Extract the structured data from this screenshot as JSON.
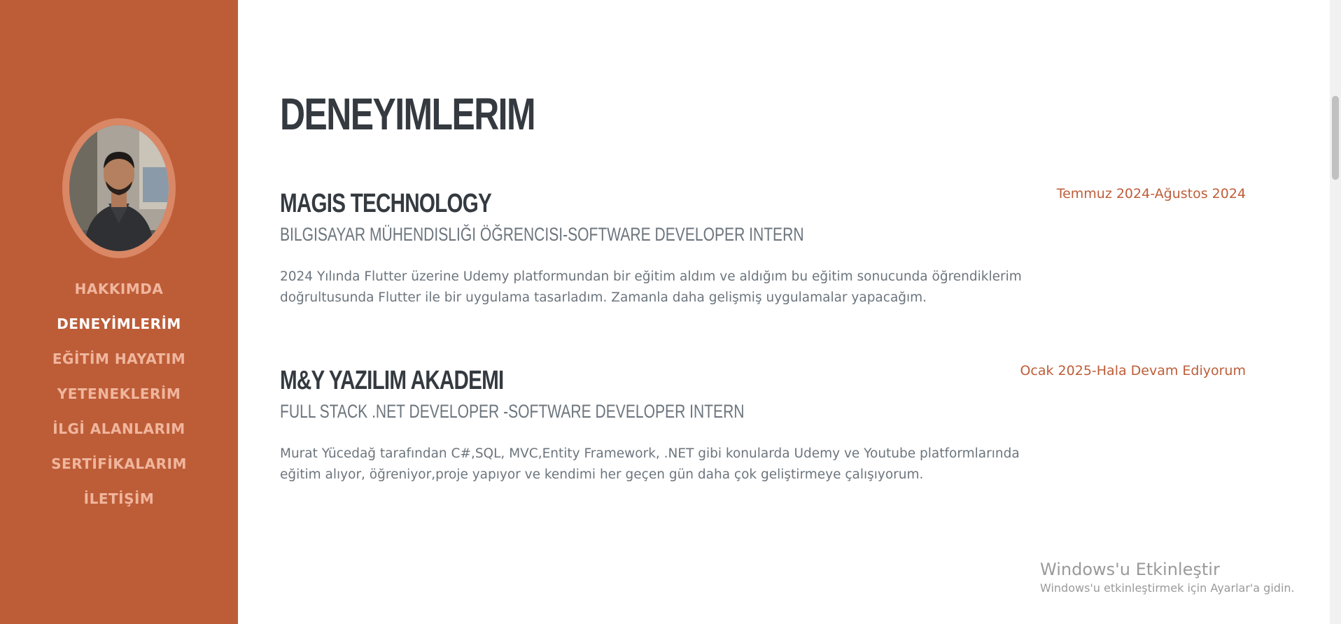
{
  "sidebar": {
    "avatar_alt": "profile-photo",
    "nav": [
      {
        "label": "HAKKIMDA",
        "active": false
      },
      {
        "label": "DENEYİMLERİM",
        "active": true
      },
      {
        "label": "EĞİTİM HAYATIM",
        "active": false
      },
      {
        "label": "YETENEKLERİM",
        "active": false
      },
      {
        "label": "İLGİ ALANLARIM",
        "active": false
      },
      {
        "label": "SERTİFİKALARIM",
        "active": false
      },
      {
        "label": "İLETİŞİM",
        "active": false
      }
    ]
  },
  "main": {
    "title": "DENEYIMLERIM",
    "experiences": [
      {
        "company": "MAGIS TECHNOLOGY",
        "role": "BILGISAYAR MÜHENDISLIĞI ÖĞRENCISI-SOFTWARE DEVELOPER INTERN",
        "description": "2024 Yılında Flutter üzerine Udemy platformundan bir eğitim aldım ve aldığım bu eğitim sonucunda öğrendiklerim doğrultusunda Flutter ile bir uygulama tasarladım. Zamanla daha gelişmiş uygulamalar yapacağım.",
        "date": "Temmuz 2024-Ağustos 2024"
      },
      {
        "company": "M&Y YAZILIM AKADEMI",
        "role": "FULL STACK .NET DEVELOPER -SOFTWARE DEVELOPER INTERN",
        "description": "Murat Yücedağ tarafından C#,SQL, MVC,Entity Framework, .NET gibi konularda Udemy ve Youtube platformlarında eğitim alıyor, öğreniyor,proje yapıyor ve kendimi her geçen gün daha çok geliştirmeye çalışıyorum.",
        "date": "Ocak 2025-Hala Devam Ediyorum"
      }
    ]
  },
  "watermark": {
    "title": "Windows'u Etkinleştir",
    "subtitle": "Windows'u etkinleştirmek için Ayarlar'a gidin."
  },
  "colors": {
    "primary": "#bd5d38",
    "nav_text": "#f0b69d",
    "heading": "#343a40",
    "muted": "#6c757d"
  }
}
